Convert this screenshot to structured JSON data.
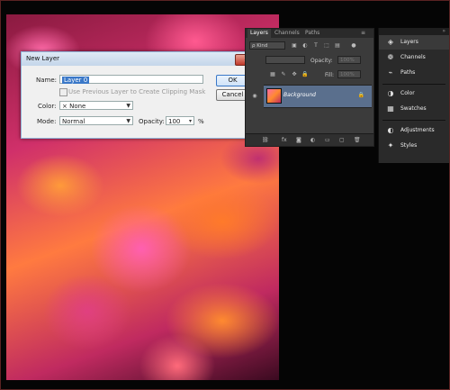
{
  "dialog": {
    "title": "New Layer",
    "close_symbol": "✕",
    "name_label": "Name:",
    "name_value": "Layer 0",
    "clipping_label": "Use Previous Layer to Create Clipping Mask",
    "color_label": "Color:",
    "color_value": "× None",
    "mode_label": "Mode:",
    "mode_value": "Normal",
    "opacity_label": "Opacity:",
    "opacity_value": "100",
    "opacity_unit": "%",
    "ok_label": "OK",
    "cancel_label": "Cancel"
  },
  "layers_panel": {
    "tabs": [
      "Layers",
      "Channels",
      "Paths"
    ],
    "kind_label": "ρ Kind",
    "opacity_label": "Opacity:",
    "opacity_value": "100%",
    "fill_label": "Fill:",
    "fill_value": "100%",
    "layer_name": "Background",
    "footer_fx": "fx"
  },
  "dock": {
    "items": [
      {
        "label": "Layers",
        "icon": "layers-icon"
      },
      {
        "label": "Channels",
        "icon": "channels-icon"
      },
      {
        "label": "Paths",
        "icon": "paths-icon"
      },
      {
        "label": "Color",
        "icon": "color-icon"
      },
      {
        "label": "Swatches",
        "icon": "swatches-icon"
      },
      {
        "label": "Adjustments",
        "icon": "adjustments-icon"
      },
      {
        "label": "Styles",
        "icon": "styles-icon"
      }
    ]
  },
  "colors": {
    "background": "#050505",
    "panel": "#3b3b3b",
    "selected_layer": "#5a6f8d",
    "dialog_accent": "#3a78c8"
  }
}
